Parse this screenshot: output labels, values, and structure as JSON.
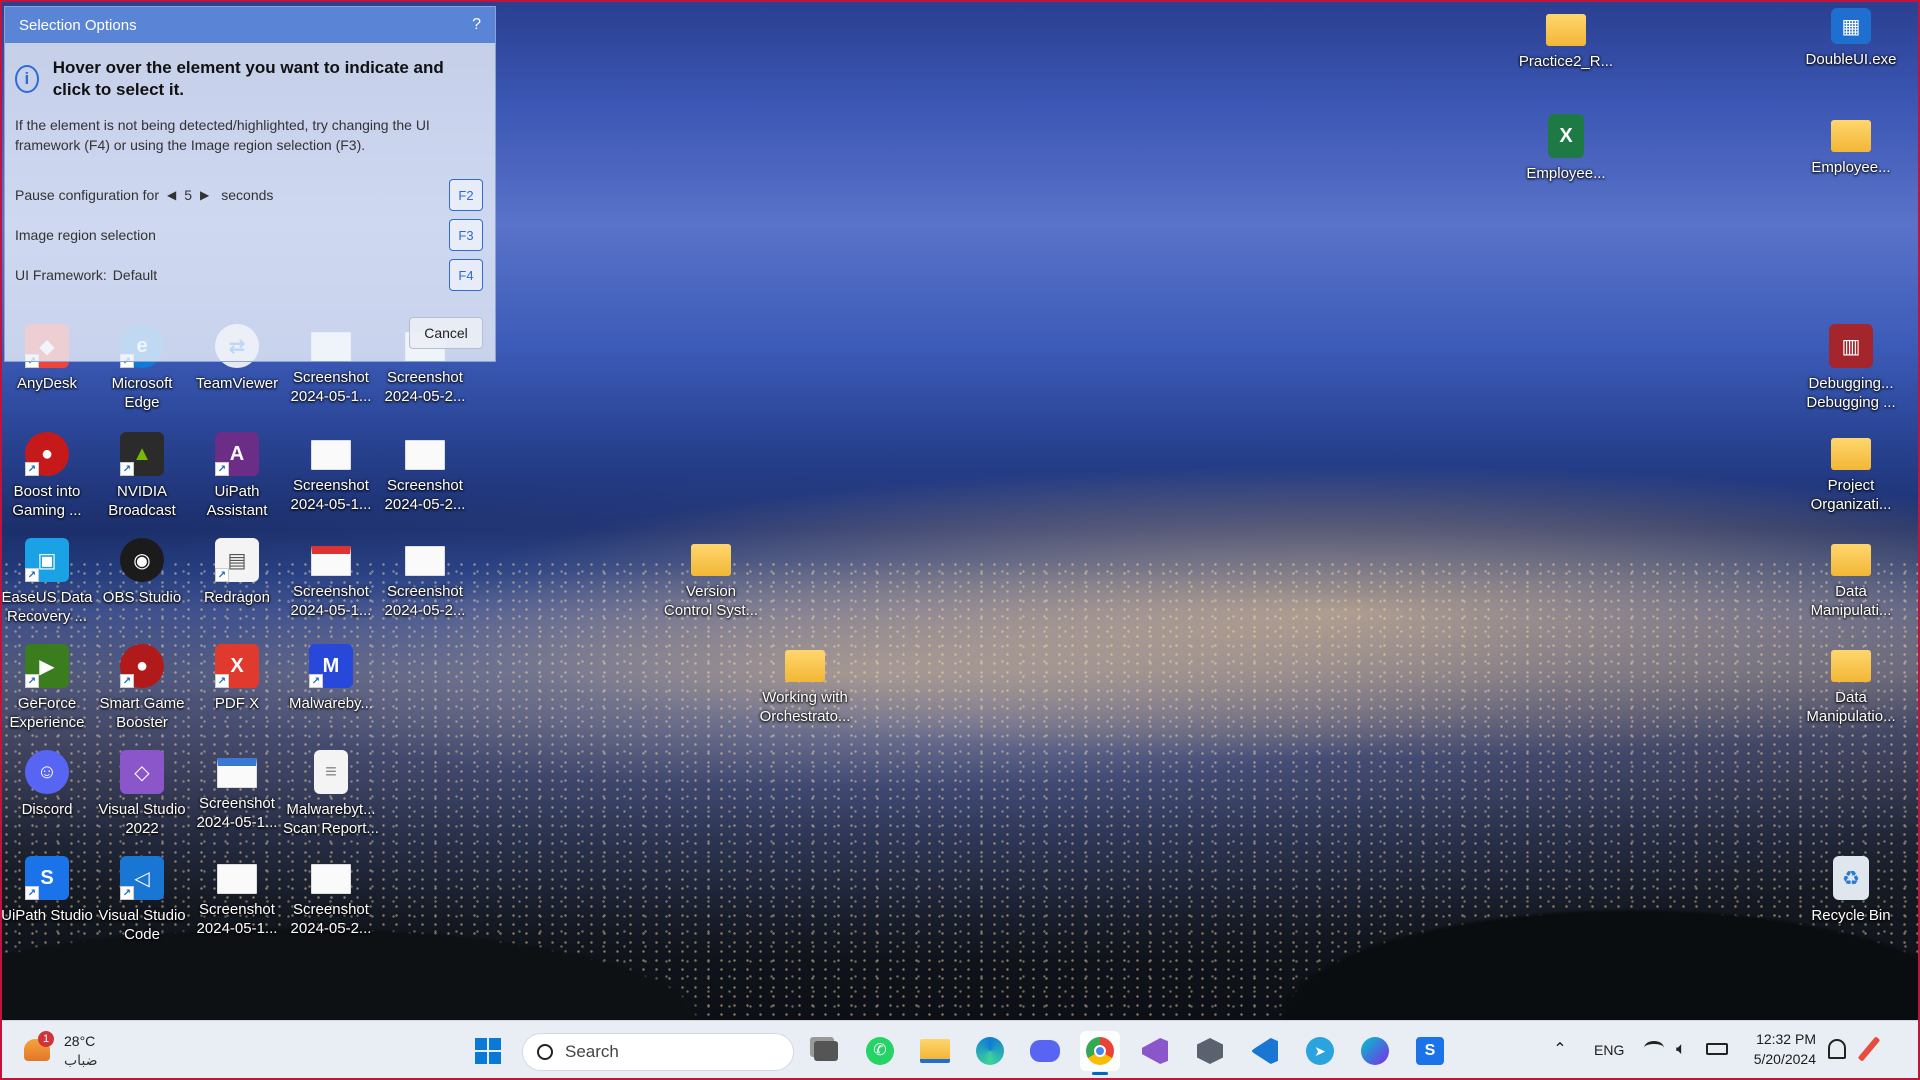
{
  "desktop": {
    "icons": [
      {
        "label": "Microsoft\nEdge",
        "glyph": "e",
        "color": "#0f7bd6"
      },
      {
        "label": "TeamViewer",
        "glyph": "⇄",
        "color": "#e6e9ef"
      },
      {
        "label": "AnyDesk",
        "glyph": "◆",
        "color": "#ef443b"
      },
      {
        "label": "Screenshot\n2024-05-1...",
        "glyph": "",
        "color": "#ffffff"
      },
      {
        "label": "Screenshot\n2024-05-2...",
        "glyph": "",
        "color": "#ffffff"
      },
      {
        "label": "Boost into\nGaming ...",
        "glyph": "●",
        "color": "#c61a1a"
      },
      {
        "label": "NVIDIA\nBroadcast",
        "glyph": "▲",
        "color": "#2b2b2b"
      },
      {
        "label": "UiPath\nAssistant",
        "glyph": "A",
        "color": "#6b2d86"
      },
      {
        "label": "Screenshot\n2024-05-1...",
        "glyph": "",
        "color": "#ffffff"
      },
      {
        "label": "Screenshot\n2024-05-2...",
        "glyph": "",
        "color": "#ffffff"
      },
      {
        "label": "EaseUS Data\nRecovery ...",
        "glyph": "▣",
        "color": "#1aa1e6"
      },
      {
        "label": "OBS Studio",
        "glyph": "◉",
        "color": "#1b1b1b"
      },
      {
        "label": "Redragon",
        "glyph": "▤",
        "color": "#f4f4f4"
      },
      {
        "label": "Screenshot\n2024-05-1...",
        "glyph": "",
        "color": "#ffffff"
      },
      {
        "label": "Screenshot\n2024-05-2...",
        "glyph": "",
        "color": "#ffffff"
      },
      {
        "label": "GeForce\nExperience",
        "glyph": "▶",
        "color": "#3b7d1e"
      },
      {
        "label": "Smart Game\nBooster",
        "glyph": "●",
        "color": "#b01a1a"
      },
      {
        "label": "PDF X",
        "glyph": "X",
        "color": "#e03a2f"
      },
      {
        "label": "Malwareby...",
        "glyph": "M",
        "color": "#2748d8"
      },
      {
        "label": "Discord",
        "glyph": "☺",
        "color": "#5865f2"
      },
      {
        "label": "Visual Studio\n2022",
        "glyph": "◇",
        "color": "#8b56c9"
      },
      {
        "label": "Screenshot\n2024-05-1...",
        "glyph": "",
        "color": "#ffffff"
      },
      {
        "label": "Malwarebyt...\nScan Report...",
        "glyph": "≡",
        "color": "#f4f4f4"
      },
      {
        "label": "UiPath Studio",
        "glyph": "S",
        "color": "#1a73e8"
      },
      {
        "label": "Visual Studio\nCode",
        "glyph": "◁",
        "color": "#1976d2"
      },
      {
        "label": "Screenshot\n2024-05-1...",
        "glyph": "",
        "color": "#ffffff"
      },
      {
        "label": "Screenshot\n2024-05-2...",
        "glyph": "",
        "color": "#ffffff"
      },
      {
        "label": "Version\nControl Syst...",
        "glyph": "",
        "color": "#f2b736"
      },
      {
        "label": "Working with\nOrchestrato...",
        "glyph": "",
        "color": "#f2b736"
      },
      {
        "label": "Practice2_R...",
        "glyph": "",
        "color": "#f2b736"
      },
      {
        "label": "DoubleUI.exe",
        "glyph": "▦",
        "color": "#1f6fd1"
      },
      {
        "label": "Employee...",
        "glyph": "X",
        "color": "#1d7a45"
      },
      {
        "label": "Employee...",
        "glyph": "",
        "color": "#f2b736"
      },
      {
        "label": "Debugging...\nDebugging ...",
        "glyph": "▥",
        "color": "#a4262c"
      },
      {
        "label": "Project\nOrganizati...",
        "glyph": "",
        "color": "#f2b736"
      },
      {
        "label": "Data\nManipulati...",
        "glyph": "",
        "color": "#f2b736"
      },
      {
        "label": "Data\nManipulatio...",
        "glyph": "",
        "color": "#f2b736"
      },
      {
        "label": "Recycle Bin",
        "glyph": "♻",
        "color": "#dfe6ee"
      }
    ]
  },
  "dialog": {
    "title": "Selection Options",
    "help": "?",
    "heading": "Hover over the element you want to indicate and click to select it.",
    "hint": "If the element is not being detected/highlighted, try changing the UI framework (F4) or using the Image region selection (F3).",
    "pause_label": "Pause configuration for",
    "pause_value": "5",
    "pause_unit": "seconds",
    "pause_key": "F2",
    "image_label": "Image region selection",
    "image_key": "F3",
    "framework_label": "UI Framework:",
    "framework_value": "Default",
    "framework_key": "F4",
    "cancel": "Cancel"
  },
  "taskbar": {
    "weather_temp": "28°C",
    "weather_desc": "ضباب",
    "weather_badge": "1",
    "search_placeholder": "Search",
    "lang": "ENG",
    "time": "12:32 PM",
    "date": "5/20/2024"
  }
}
